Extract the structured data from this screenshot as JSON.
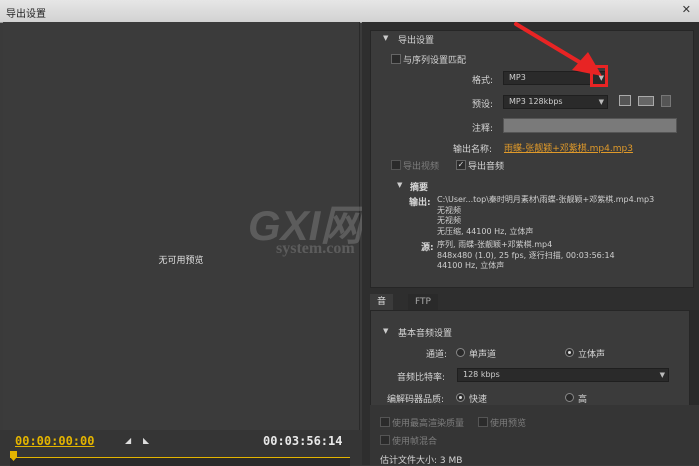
{
  "window": {
    "title": "导出设置",
    "close_glyph": "✕"
  },
  "preview": {
    "no_preview": "无可用预览"
  },
  "timeline": {
    "in_time": "00:00:00:00",
    "duration": "00:03:56:14",
    "accent": "#e3b400"
  },
  "export_settings": {
    "section_title": "导出设置",
    "match_sequence_label": "与序列设置匹配",
    "format_label": "格式:",
    "format_value": "MP3",
    "preset_label": "预设:",
    "preset_value": "MP3 128kbps",
    "comment_label": "注释:",
    "output_name_label": "输出名称:",
    "output_name_value": "雨蝶-张靓颖+邓紫棋.mp4.mp3",
    "export_video_label": "导出视频",
    "export_audio_label": "导出音频"
  },
  "summary": {
    "title": "摘要",
    "output_label": "输出:",
    "output_lines": [
      "C:\\User...top\\秦时明月素材\\雨蝶-张靓颖+邓紫棋.mp4.mp3",
      "无视频",
      "无视频",
      "无压缩, 44100 Hz, 立体声"
    ],
    "source_label": "源:",
    "source_lines": [
      "序列, 雨蝶-张靓颖+邓紫棋.mp4",
      "848x480 (1.0), 25 fps, 逐行扫描, 00:03:56:14",
      "44100 Hz, 立体声"
    ]
  },
  "tabs": [
    "音频",
    "FTP"
  ],
  "audio": {
    "section_title": "基本音频设置",
    "channel_label": "通道:",
    "mono_label": "单声道",
    "stereo_label": "立体声",
    "bitrate_label": "音频比特率:",
    "bitrate_value": "128 kbps",
    "codec_quality_label": "编解码器品质:",
    "fast_label": "快速",
    "high_label": "高"
  },
  "bottom": {
    "max_render_label": "使用最高渲染质量",
    "use_preview_label": "使用预览",
    "frame_blend_label": "使用帧混合",
    "est_size": "估计文件大小: 3 MB"
  },
  "watermark": {
    "brand": "GXI网",
    "domain": "system.com"
  },
  "annotation_color": "#e82424"
}
